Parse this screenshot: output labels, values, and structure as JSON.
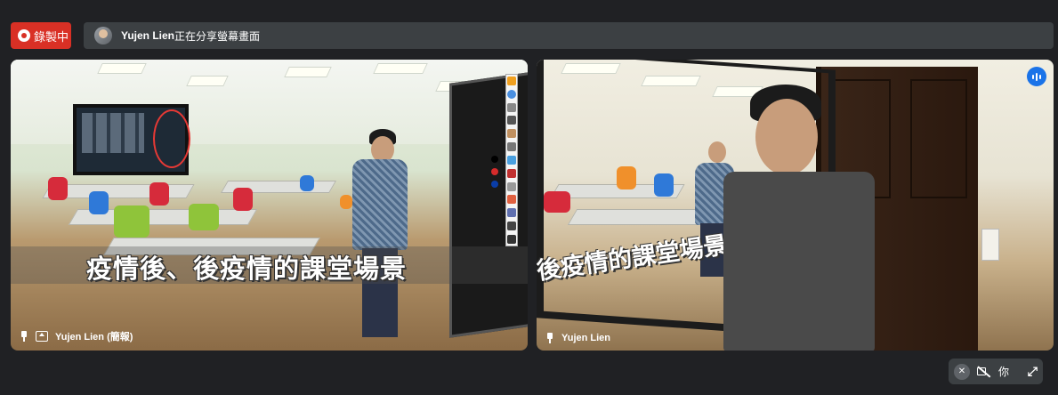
{
  "recording": {
    "label": "錄製中"
  },
  "share_banner": {
    "presenter": "Yujen Lien",
    "message": "正在分享螢幕畫面"
  },
  "tiles": [
    {
      "participant": "Yujen Lien (簡報)",
      "subtitle": "疫情後、後疫情的課堂場景",
      "pinned": false,
      "presenting": true
    },
    {
      "participant": "Yujen Lien",
      "subtitle": "後疫情的課堂場景",
      "speaking": true
    }
  ],
  "self_view": {
    "label": "你",
    "mic": "off",
    "camera": "off"
  },
  "colors": {
    "recording": "#d93025",
    "speaking": "#1a73e8",
    "bar": "#3c4043",
    "background": "#202124"
  },
  "icons": [
    "record-dot-icon",
    "pin-icon",
    "present-to-all-icon",
    "speaking-indicator-icon",
    "mic-off-icon",
    "camera-off-icon",
    "expand-icon"
  ]
}
